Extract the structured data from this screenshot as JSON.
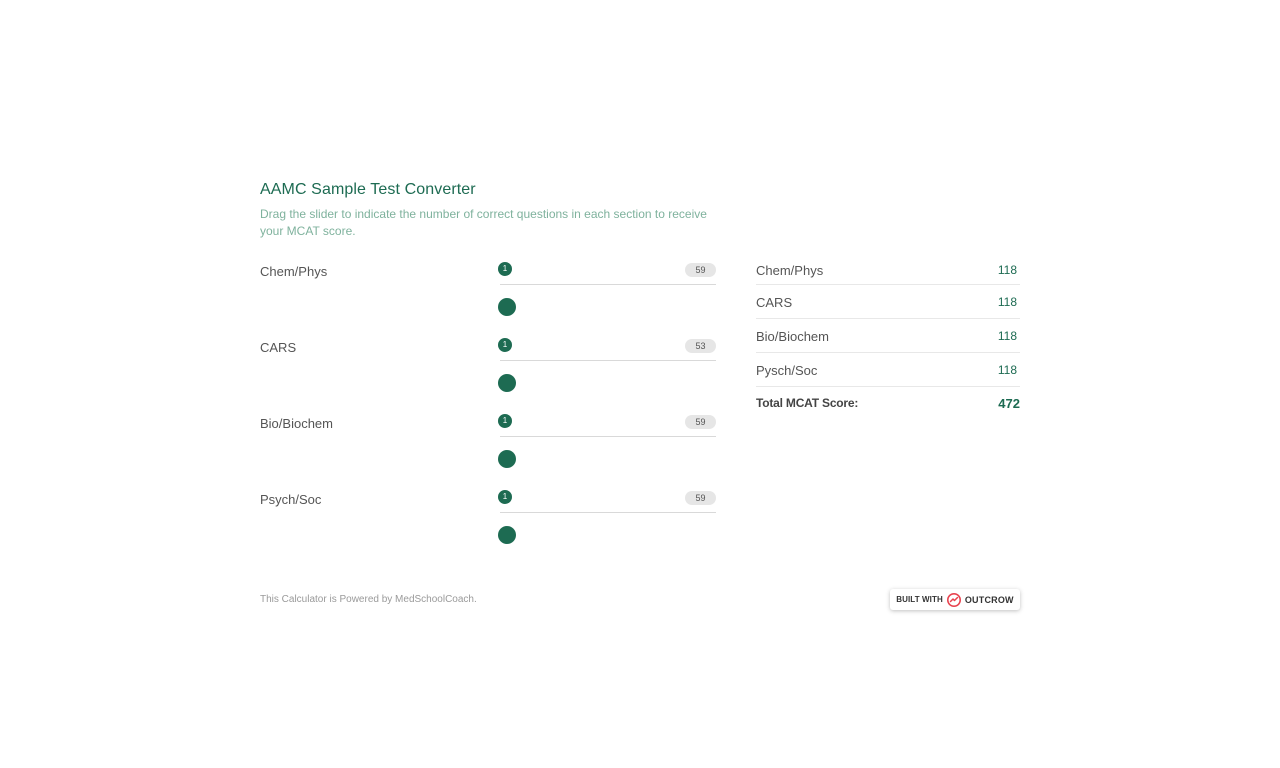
{
  "header": {
    "title": "AAMC Sample Test Converter",
    "subtitle": "Drag the slider to indicate the number of correct questions in each section to receive your MCAT score."
  },
  "sliders": [
    {
      "label": "Chem/Phys",
      "min": "1",
      "max": "59",
      "value": 1
    },
    {
      "label": "CARS",
      "min": "1",
      "max": "53",
      "value": 1
    },
    {
      "label": "Bio/Biochem",
      "min": "1",
      "max": "59",
      "value": 1
    },
    {
      "label": "Psych/Soc",
      "min": "1",
      "max": "59",
      "value": 1
    }
  ],
  "results": {
    "rows": [
      {
        "label": "Chem/Phys",
        "value": "118"
      },
      {
        "label": "CARS",
        "value": "118"
      },
      {
        "label": "Bio/Biochem",
        "value": "118"
      },
      {
        "label": "Pysch/Soc",
        "value": "118"
      }
    ],
    "total_label": "Total MCAT Score:",
    "total_value": "472"
  },
  "footer": {
    "text": "This Calculator is Powered by MedSchoolCoach.",
    "built_with": "BUILT WITH",
    "brand": "OUTCROW"
  },
  "icons": {
    "brand_logo": "outgrow-logo-icon"
  },
  "colors": {
    "accent": "#1d6b52",
    "subtitle": "#7fb29d",
    "brand_red": "#e8434f"
  }
}
